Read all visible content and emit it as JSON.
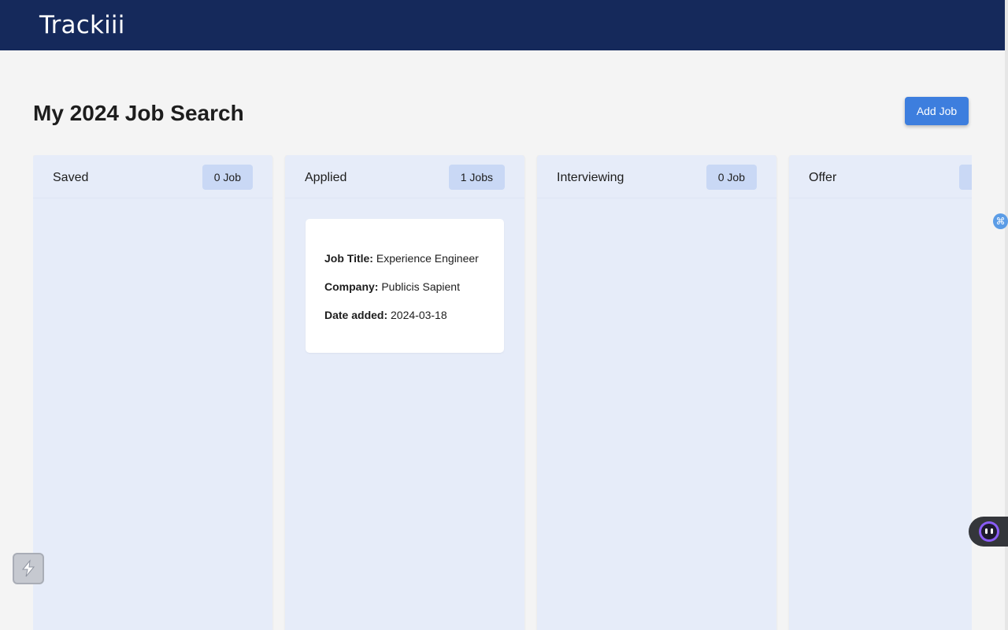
{
  "app": {
    "title": "Trackiii"
  },
  "page": {
    "title": "My 2024 Job Search",
    "add_button": "Add Job"
  },
  "columns": [
    {
      "title": "Saved",
      "count": "0 Job",
      "cards": []
    },
    {
      "title": "Applied",
      "count": "1 Jobs",
      "cards": [
        {
          "job_title_label": "Job Title:",
          "job_title": "Experience Engineer",
          "company_label": "Company:",
          "company": "Publicis Sapient",
          "date_label": "Date added:",
          "date": "2024-03-18"
        }
      ]
    },
    {
      "title": "Interviewing",
      "count": "0 Job",
      "cards": []
    },
    {
      "title": "Offer",
      "count": "",
      "cards": []
    }
  ],
  "overlays": {
    "left_icon": "bolt-extension-icon",
    "right_icon": "robot-assistant-icon",
    "edge_badge": "command-icon",
    "edge_badge_glyph": "⌘"
  },
  "colors": {
    "header": "#15295b",
    "accent": "#3d7ede",
    "column_bg": "#e6ecf9",
    "badge_bg": "#c9d8f5"
  }
}
